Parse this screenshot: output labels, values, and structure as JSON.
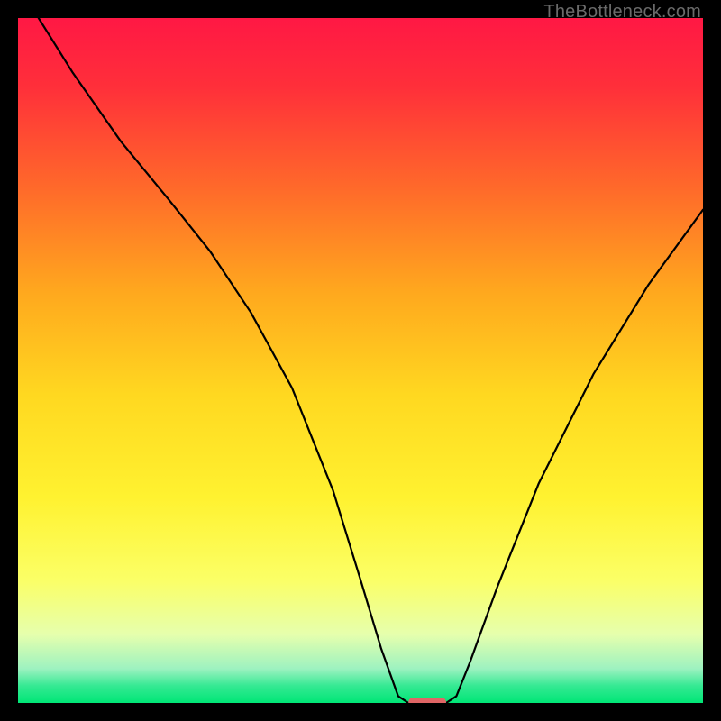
{
  "watermark": "TheBottleneck.com",
  "chart_data": {
    "type": "line",
    "title": "",
    "xlabel": "",
    "ylabel": "",
    "xlim": [
      0,
      100
    ],
    "ylim": [
      0,
      100
    ],
    "grid": false,
    "legend": "",
    "gradient_stops": [
      {
        "offset": 0.0,
        "color": "#ff1844"
      },
      {
        "offset": 0.1,
        "color": "#ff2f3a"
      },
      {
        "offset": 0.25,
        "color": "#ff6a2a"
      },
      {
        "offset": 0.4,
        "color": "#ffa81e"
      },
      {
        "offset": 0.55,
        "color": "#ffd820"
      },
      {
        "offset": 0.7,
        "color": "#fff230"
      },
      {
        "offset": 0.82,
        "color": "#fbff66"
      },
      {
        "offset": 0.9,
        "color": "#e6ffad"
      },
      {
        "offset": 0.95,
        "color": "#9df2c0"
      },
      {
        "offset": 0.975,
        "color": "#35e993"
      },
      {
        "offset": 1.0,
        "color": "#00e676"
      }
    ],
    "series": [
      {
        "name": "bottleneck-curve",
        "x": [
          3,
          8,
          15,
          22,
          28,
          34,
          40,
          46,
          50,
          53,
          55.5,
          57,
          62.5,
          64,
          66,
          70,
          76,
          84,
          92,
          100
        ],
        "values": [
          100,
          92,
          82,
          73.5,
          66,
          57,
          46,
          31,
          18,
          8,
          1,
          0,
          0,
          1,
          6,
          17,
          32,
          48,
          61,
          72
        ]
      }
    ],
    "marker": {
      "x_start": 57,
      "x_end": 62.5,
      "y": 0,
      "color": "#e06666"
    }
  }
}
